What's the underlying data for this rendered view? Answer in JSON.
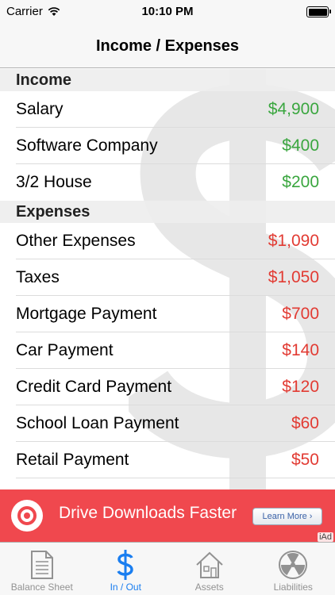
{
  "status_bar": {
    "carrier": "Carrier",
    "time": "10:10 PM"
  },
  "nav": {
    "title": "Income / Expenses"
  },
  "income": {
    "header": "Income",
    "items": [
      {
        "label": "Salary",
        "amount": "$4,900"
      },
      {
        "label": "Software Company",
        "amount": "$400"
      },
      {
        "label": "3/2 House",
        "amount": "$200"
      }
    ]
  },
  "expenses": {
    "header": "Expenses",
    "items": [
      {
        "label": "Other Expenses",
        "amount": "$1,090"
      },
      {
        "label": "Taxes",
        "amount": "$1,050"
      },
      {
        "label": "Mortgage Payment",
        "amount": "$700"
      },
      {
        "label": "Car Payment",
        "amount": "$140"
      },
      {
        "label": "Credit Card Payment",
        "amount": "$120"
      },
      {
        "label": "School Loan Payment",
        "amount": "$60"
      },
      {
        "label": "Retail Payment",
        "amount": "$50"
      }
    ]
  },
  "ad": {
    "text": "Drive Downloads Faster",
    "button": "Learn More ›",
    "badge": "iAd"
  },
  "tabs": [
    {
      "label": "Balance Sheet",
      "icon": "document-icon"
    },
    {
      "label": "In / Out",
      "icon": "dollar-icon"
    },
    {
      "label": "Assets",
      "icon": "house-icon"
    },
    {
      "label": "Liabilities",
      "icon": "radiation-icon"
    }
  ],
  "colors": {
    "income": "#3aa63f",
    "expense": "#e23b33",
    "active_tab": "#1a7ef0",
    "ad_background": "#f0484e"
  }
}
